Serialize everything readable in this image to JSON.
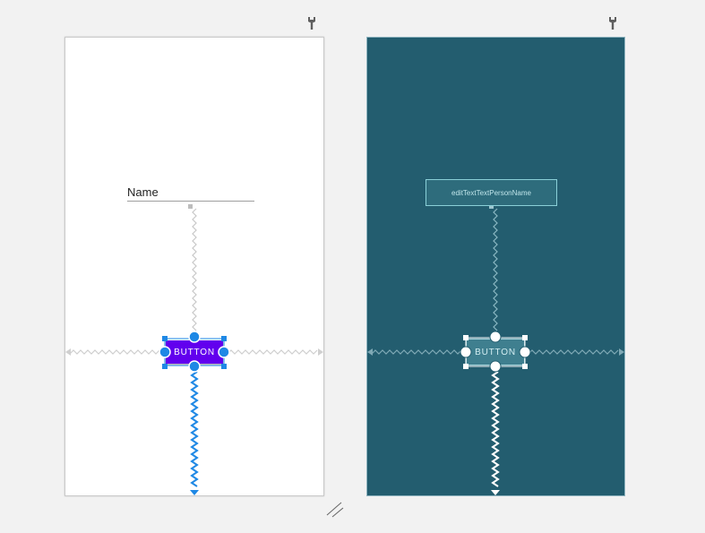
{
  "design": {
    "edit_text_hint": "Name",
    "button_label": "BUTTON"
  },
  "blueprint": {
    "edit_text_id": "editTextTextPersonName",
    "button_label": "BUTTON"
  },
  "colors": {
    "canvas_background": "#f2f2f2",
    "design_surface": "#ffffff",
    "blueprint_surface": "#235d6f",
    "button_primary": "#6200ee",
    "selection_accent": "#2196f3"
  },
  "icons": {
    "design_panel_settings": "wrench-icon",
    "blueprint_panel_settings": "wrench-icon",
    "resize_handle": "resize-corner-icon"
  }
}
